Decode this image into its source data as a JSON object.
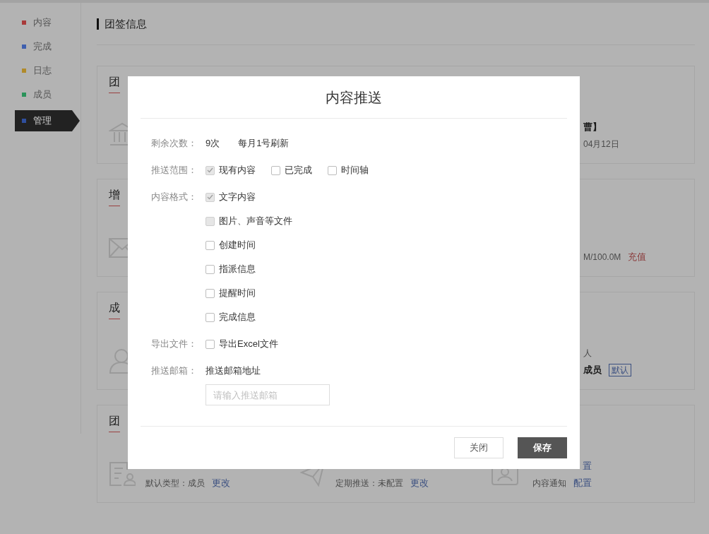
{
  "sidebar": {
    "items": [
      {
        "label": "内容",
        "color": "#a83a3a",
        "selected": false
      },
      {
        "label": "完成",
        "color": "#3f5fae",
        "selected": false
      },
      {
        "label": "日志",
        "color": "#b08a2a",
        "selected": false
      },
      {
        "label": "成员",
        "color": "#2a935a",
        "selected": false
      },
      {
        "label": "管理",
        "color": "#2f4f9e",
        "selected": true
      }
    ]
  },
  "page_title": "团签信息",
  "cards": [
    {
      "kind": "side",
      "title": "团",
      "lines": [
        [
          {
            "text": "曹】",
            "kind": "strong"
          }
        ],
        [
          {
            "text": "04月12日",
            "kind": "plain"
          }
        ]
      ]
    },
    {
      "kind": "side",
      "title": "增",
      "lines": [
        [
          {
            "text": "M/100.0M",
            "kind": "plain"
          },
          {
            "text": "充值",
            "kind": "alert"
          }
        ]
      ]
    },
    {
      "kind": "side",
      "title": "成",
      "lines": [
        [
          {
            "text": "人",
            "kind": "plain"
          }
        ],
        [
          {
            "text": "成员",
            "kind": "strong"
          },
          {
            "text": "默认",
            "kind": "badge"
          }
        ]
      ]
    },
    {
      "kind": "columns",
      "title": "团",
      "columns": [
        {
          "lines": [
            [
              {
                "text": "默认类型：成员",
                "kind": "plain"
              },
              {
                "text": "更改",
                "kind": "link"
              }
            ]
          ]
        },
        {
          "lines": [
            [
              {
                "text": "定期推送：未配置",
                "kind": "plain"
              },
              {
                "text": "更改",
                "kind": "link"
              }
            ]
          ]
        },
        {
          "lines": [
            [
              {
                "text": "置",
                "kind": "link"
              }
            ],
            [
              {
                "text": "内容通知",
                "kind": "plain"
              },
              {
                "text": "配置",
                "kind": "link"
              }
            ]
          ]
        }
      ]
    }
  ],
  "dialog": {
    "title": "内容推送",
    "rows": [
      {
        "label": "剩余次数：",
        "kind": "text",
        "values": [
          "9次",
          "每月1号刷新"
        ]
      },
      {
        "label": "推送范围：",
        "kind": "checks-inline",
        "options": [
          {
            "label": "现有内容",
            "checked": true,
            "disabled": true
          },
          {
            "label": "已完成",
            "checked": false,
            "disabled": false
          },
          {
            "label": "时间轴",
            "checked": false,
            "disabled": false
          }
        ]
      },
      {
        "label": "内容格式：",
        "kind": "checks-stacked",
        "options": [
          {
            "label": "文字内容",
            "checked": true,
            "disabled": true
          },
          {
            "label": "图片、声音等文件",
            "checked": false,
            "disabled": true
          },
          {
            "label": "创建时间",
            "checked": false,
            "disabled": false
          },
          {
            "label": "指派信息",
            "checked": false,
            "disabled": false
          },
          {
            "label": "提醒时间",
            "checked": false,
            "disabled": false
          },
          {
            "label": "完成信息",
            "checked": false,
            "disabled": false
          }
        ]
      },
      {
        "label": "导出文件：",
        "kind": "checks-stacked",
        "options": [
          {
            "label": "导出Excel文件",
            "checked": false,
            "disabled": false
          }
        ]
      },
      {
        "label": "推送邮箱：",
        "kind": "email",
        "text": "推送邮箱地址",
        "placeholder": "请输入推送邮箱"
      }
    ],
    "buttons": [
      {
        "label": "关闭",
        "kind": "secondary"
      },
      {
        "label": "保存",
        "kind": "primary"
      }
    ]
  }
}
